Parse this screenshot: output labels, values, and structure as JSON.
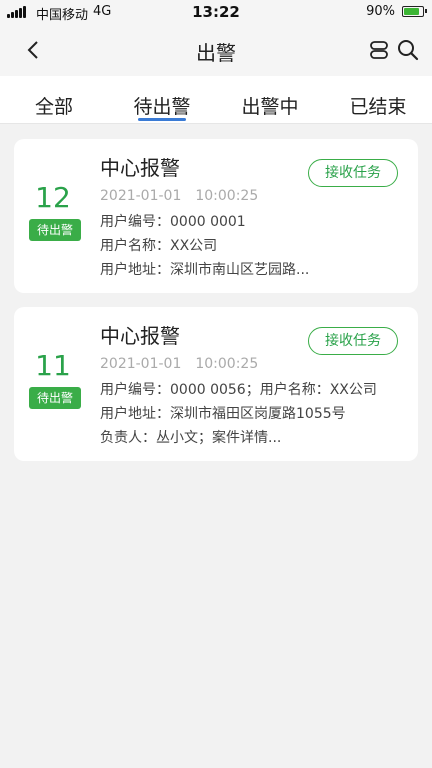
{
  "status_bar": {
    "carrier": "中国移动",
    "network": "4G",
    "time": "13:22",
    "battery": "90%",
    "battery_level": 0.9
  },
  "nav": {
    "title": "出警"
  },
  "tabs": [
    {
      "label": "全部"
    },
    {
      "label": "待出警"
    },
    {
      "label": "出警中"
    },
    {
      "label": "已结束"
    }
  ],
  "active_tab": "待出警",
  "accent_colors": {
    "green": "#2aa24a",
    "tab_indicator": "#3a7bd5"
  },
  "cards": [
    {
      "count": "12",
      "status": "待出警",
      "title": "中心报警",
      "time": "2021-01-01　10:00:25",
      "action": "接收任务",
      "lines": [
        "用户编号：0000 0001",
        "用户名称：XX公司",
        "用户地址：深圳市南山区艺园路..."
      ]
    },
    {
      "count": "11",
      "status": "待出警",
      "title": "中心报警",
      "time": "2021-01-01　10:00:25",
      "action": "接收任务",
      "lines": [
        "用户编号：0000 0056；用户名称：XX公司",
        "用户地址：深圳市福田区岗厦路1055号",
        "负责人：丛小文；案件详情..."
      ]
    }
  ]
}
